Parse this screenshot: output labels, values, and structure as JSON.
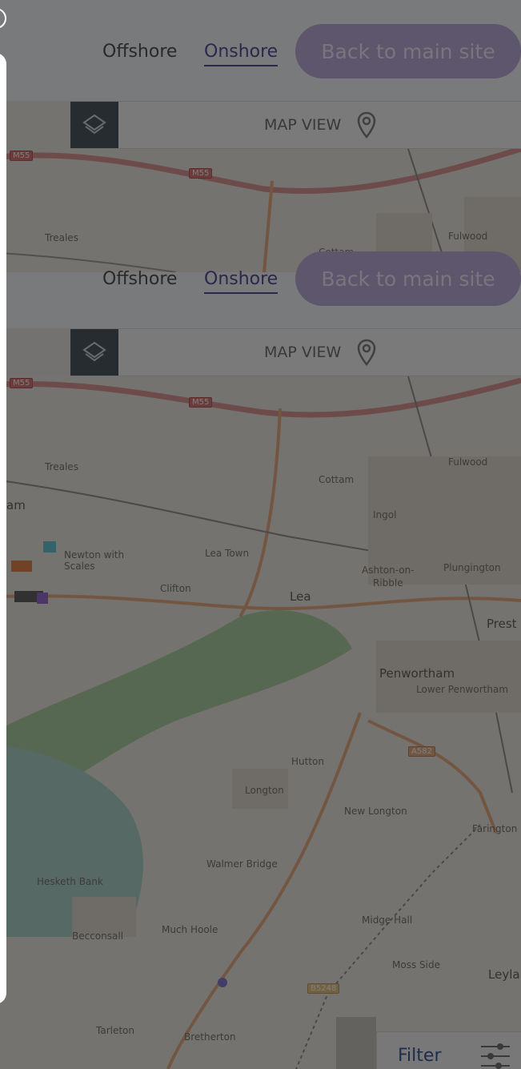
{
  "header": {
    "offshore": "Offshore",
    "onshore": "Onshore",
    "back_button": "Back to main site"
  },
  "mapbar": {
    "label": "MAP VIEW",
    "layers_icon": "layers-icon",
    "pin_icon": "map-pin-icon"
  },
  "map_upper": {
    "labels": {
      "m55a": "M55",
      "m55b": "M55",
      "treales": "Treales",
      "cottam": "Cottam",
      "fulwood": "Fulwood"
    }
  },
  "map_main": {
    "labels": {
      "m55a": "M55",
      "m55b": "M55",
      "treales": "Treales",
      "cottam": "Cottam",
      "fulwood": "Fulwood",
      "ingol": "Ingol",
      "am": "am",
      "newton": "Newton with\nScales",
      "lea_town": "Lea Town",
      "clifton": "Clifton",
      "lea": "Lea",
      "ashton": "Ashton-on-\nRibble",
      "plungington": "Plungington",
      "prest": "Prest",
      "penwortham": "Penwortham",
      "lower_penwortham": "Lower Penwortham",
      "a582": "A582",
      "hutton": "Hutton",
      "longton": "Longton",
      "new_longton": "New Longton",
      "farington": "Farington",
      "walmer_bridge": "Walmer Bridge",
      "hesketh_bank": "Hesketh Bank",
      "midge_hall": "Midge Hall",
      "much_hoole": "Much Hoole",
      "becconsall": "Becconsall",
      "moss_side": "Moss Side",
      "leyla": "Leyla",
      "b5248": "B5248",
      "tarleton": "Tarleton",
      "bretherton": "Bretherton"
    }
  },
  "filter": {
    "label": "Filter",
    "icon": "sliders-icon"
  },
  "colors": {
    "accent": "#4a3f8f",
    "button": "#b9a6d8",
    "filter_text": "#2e4b8f"
  }
}
